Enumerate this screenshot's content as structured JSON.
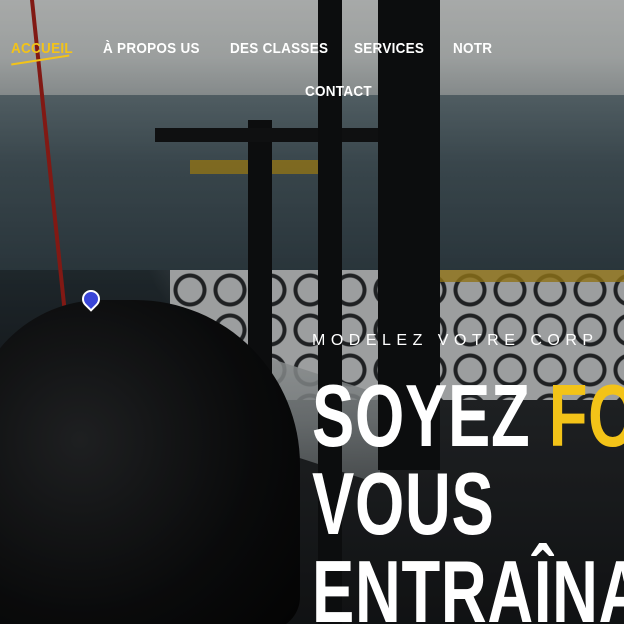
{
  "nav": {
    "items": [
      {
        "label": "ACCUEIL",
        "active": true
      },
      {
        "label": "À PROPOS US",
        "active": false
      },
      {
        "label": "DES CLASSES",
        "active": false
      },
      {
        "label": "SERVICES",
        "active": false
      },
      {
        "label": "NOTR",
        "active": false
      },
      {
        "label": "CONTACT",
        "active": false
      }
    ]
  },
  "hero": {
    "tagline": "MODELEZ VOTRE CORP",
    "headline_line1_white": "SOYEZ ",
    "headline_line1_accent": "FO",
    "headline_line2": "VOUS",
    "headline_line3": "ENTRAÎNA"
  },
  "icons": {
    "map_marker": "location-pin-icon"
  },
  "colors": {
    "accent": "#f3c318",
    "text": "#ffffff"
  }
}
